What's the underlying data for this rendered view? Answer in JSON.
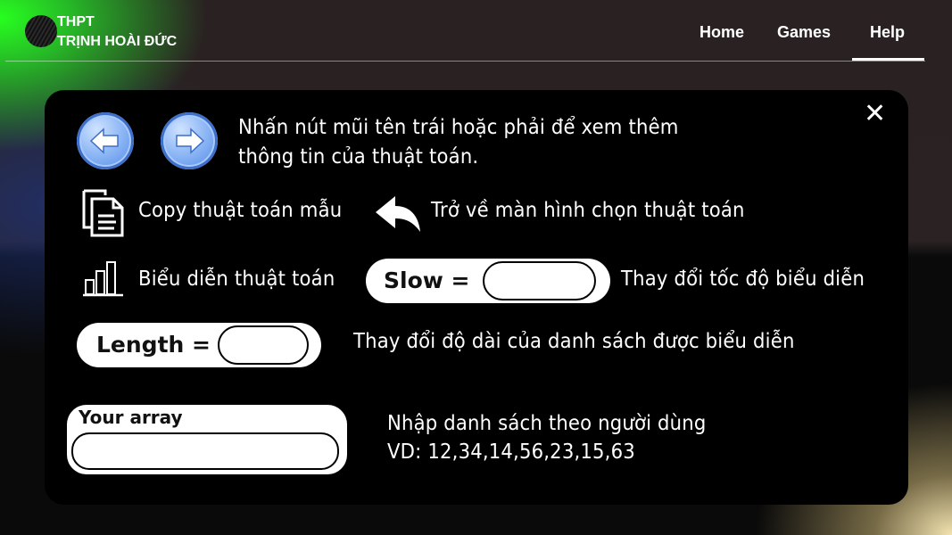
{
  "header": {
    "brand_line1": "THPT",
    "brand_line2": "TRỊNH HOÀI ĐỨC",
    "nav": [
      {
        "label": "Home"
      },
      {
        "label": "Games"
      },
      {
        "label": "Help",
        "active": true
      }
    ]
  },
  "help": {
    "arrows_text_line1": "Nhấn nút mũi tên trái hoặc phải để xem thêm",
    "arrows_text_line2": "thông tin của thuật toán.",
    "copy_text": "Copy thuật toán mẫu",
    "back_text": "Trở về màn hình chọn thuật toán",
    "visualize_text": "Biểu diễn thuật toán",
    "slow_label": "Slow =",
    "slow_desc": "Thay đổi tốc độ biểu diễn",
    "length_label": "Length =",
    "length_desc": "Thay đổi độ dài của danh sách được biểu diễn",
    "array_label": "Your array",
    "array_desc_line1": "Nhập danh sách theo người dùng",
    "array_desc_line2": "VD: 12,34,14,56,23,15,63"
  },
  "icons": {
    "close": "close-icon",
    "left": "arrow-left-icon",
    "right": "arrow-right-icon",
    "copy": "copy-icon",
    "back": "reply-back-icon",
    "chart": "bar-chart-icon"
  },
  "colors": {
    "accent_green": "#27ff1f",
    "button_blue": "#6a9cef",
    "panel": "#000000"
  }
}
